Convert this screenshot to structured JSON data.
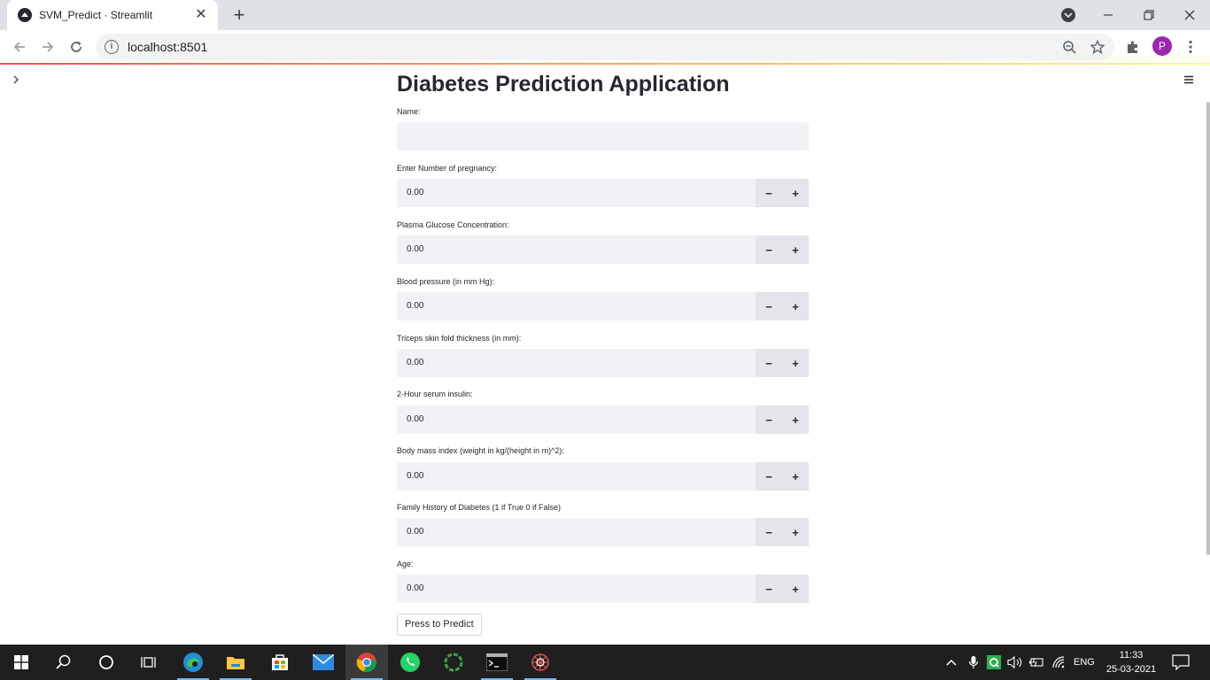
{
  "browser": {
    "tab_title": "SVM_Predict · Streamlit",
    "url": "localhost:8501",
    "profile_initial": "P",
    "new_tab_glyph": "+",
    "close_tab_glyph": "✕",
    "profile_color": "#9c27b0"
  },
  "app": {
    "title": "Diabetes Prediction Application",
    "name_label": "Name:",
    "name_value": "",
    "fields": [
      {
        "label": "Enter Number of pregnancy:",
        "value": "0.00"
      },
      {
        "label": "Plasma Glucose Concentration:",
        "value": "0.00"
      },
      {
        "label": "Blood pressure (in mm Hg):",
        "value": "0.00"
      },
      {
        "label": "Triceps skin fold thickness (in mm):",
        "value": "0.00"
      },
      {
        "label": "2-Hour serum insulin:",
        "value": "0.00"
      },
      {
        "label": "Body mass index (weight in kg/(height in m)^2):",
        "value": "0.00"
      },
      {
        "label": "Family History of Diabetes (1 if True 0 if False)",
        "value": "0.00"
      },
      {
        "label": "Age:",
        "value": "0.00"
      }
    ],
    "minus_glyph": "−",
    "plus_glyph": "+",
    "predict_button": "Press to Predict",
    "accent_color": "#ff4b4b"
  },
  "taskbar": {
    "apps": [
      "start-icon",
      "search-icon",
      "cortana-icon",
      "task-view-icon",
      "edge-icon",
      "file-explorer-icon",
      "store-icon",
      "mail-icon",
      "chrome-icon",
      "whatsapp-icon",
      "app-ring-icon",
      "terminal-icon",
      "spider-app-icon"
    ],
    "language": "ENG",
    "time": "11:33",
    "date": "25-03-2021"
  }
}
